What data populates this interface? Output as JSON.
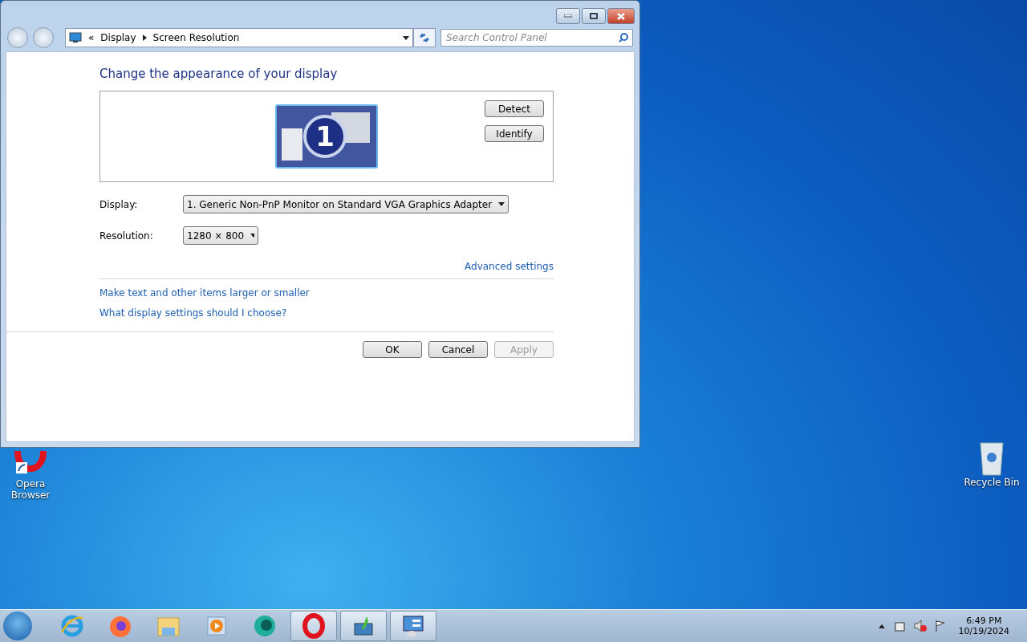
{
  "window": {
    "address": {
      "overflow": "«",
      "crumbs": [
        "Display",
        "Screen Resolution"
      ]
    },
    "search": {
      "placeholder": "Search Control Panel"
    }
  },
  "heading": "Change the appearance of your display",
  "monitor": {
    "number": "1"
  },
  "preview_buttons": [
    {
      "label": "Detect"
    },
    {
      "label": "Identify"
    }
  ],
  "fields": [
    {
      "label": "Display:",
      "value": "1. Generic Non-PnP Monitor on Standard VGA Graphics Adapter"
    },
    {
      "label": "Resolution:",
      "value": "1280 × 800"
    }
  ],
  "advanced_link": "Advanced settings",
  "links": [
    "Make text and other items larger or smaller",
    "What display settings should I choose?"
  ],
  "buttons": [
    {
      "label": "OK",
      "disabled": false
    },
    {
      "label": "Cancel",
      "disabled": false
    },
    {
      "label": "Apply",
      "disabled": true
    }
  ],
  "desktop_icons": [
    {
      "kind": "opera",
      "label": "Opera Browser"
    },
    {
      "kind": "bin",
      "label": "Recycle Bin"
    }
  ],
  "taskbar": {
    "items": [
      {
        "kind": "ie",
        "open": false
      },
      {
        "kind": "firefox",
        "open": false
      },
      {
        "kind": "folder",
        "open": false
      },
      {
        "kind": "media",
        "open": false
      },
      {
        "kind": "orb",
        "open": false
      },
      {
        "kind": "opera",
        "open": true
      },
      {
        "kind": "monitor",
        "open": true
      },
      {
        "kind": "panel",
        "open": true
      }
    ],
    "clock": {
      "time": "6:49 PM",
      "date": "10/19/2024"
    }
  }
}
